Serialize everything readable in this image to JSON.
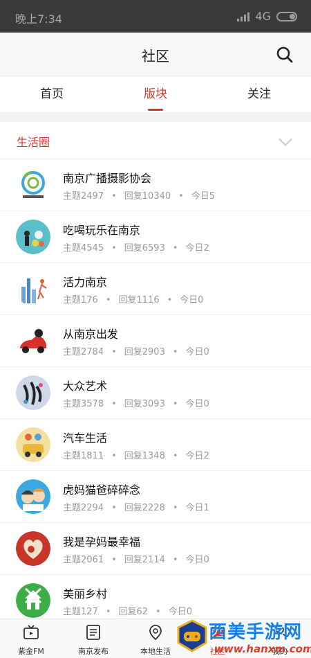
{
  "status_bar": {
    "time": "晚上7:34",
    "network": "4G"
  },
  "header": {
    "title": "社区"
  },
  "tabs": [
    {
      "label": "首页"
    },
    {
      "label": "版块"
    },
    {
      "label": "关注"
    }
  ],
  "section": {
    "label": "生活圈"
  },
  "forums": [
    {
      "name": "南京广播摄影协会",
      "topics": "主题2497",
      "replies": "回复10340",
      "today": "今日5"
    },
    {
      "name": "吃喝玩乐在南京",
      "topics": "主题4545",
      "replies": "回复6593",
      "today": "今日2"
    },
    {
      "name": "活力南京",
      "topics": "主题176",
      "replies": "回复1116",
      "today": "今日0"
    },
    {
      "name": "从南京出发",
      "topics": "主题2784",
      "replies": "回复2903",
      "today": "今日0"
    },
    {
      "name": "大众艺术",
      "topics": "主题3578",
      "replies": "回复3093",
      "today": "今日0"
    },
    {
      "name": "汽车生活",
      "topics": "主题1811",
      "replies": "回复1348",
      "today": "今日2"
    },
    {
      "name": "虎妈猫爸碎碎念",
      "topics": "主题2294",
      "replies": "回复2228",
      "today": "今日1"
    },
    {
      "name": "我是孕妈最幸福",
      "topics": "主题2061",
      "replies": "回复2114",
      "today": "今日0"
    },
    {
      "name": "美丽乡村",
      "topics": "主题127",
      "replies": "回复62",
      "today": "今日0"
    }
  ],
  "bottom_nav": [
    {
      "label": "紫金FM",
      "icon": "tv-icon"
    },
    {
      "label": "南京发布",
      "icon": "document-icon"
    },
    {
      "label": "本地生活",
      "icon": "location-pin-icon"
    },
    {
      "label": "社区",
      "icon": "community-icon"
    },
    {
      "label": "我的",
      "icon": "profile-icon"
    }
  ],
  "watermark": {
    "text": "西美手游网",
    "url": "www.hanxm.com"
  },
  "colors": {
    "accent": "#d9362b",
    "status_bar": "#3a3a3a"
  }
}
